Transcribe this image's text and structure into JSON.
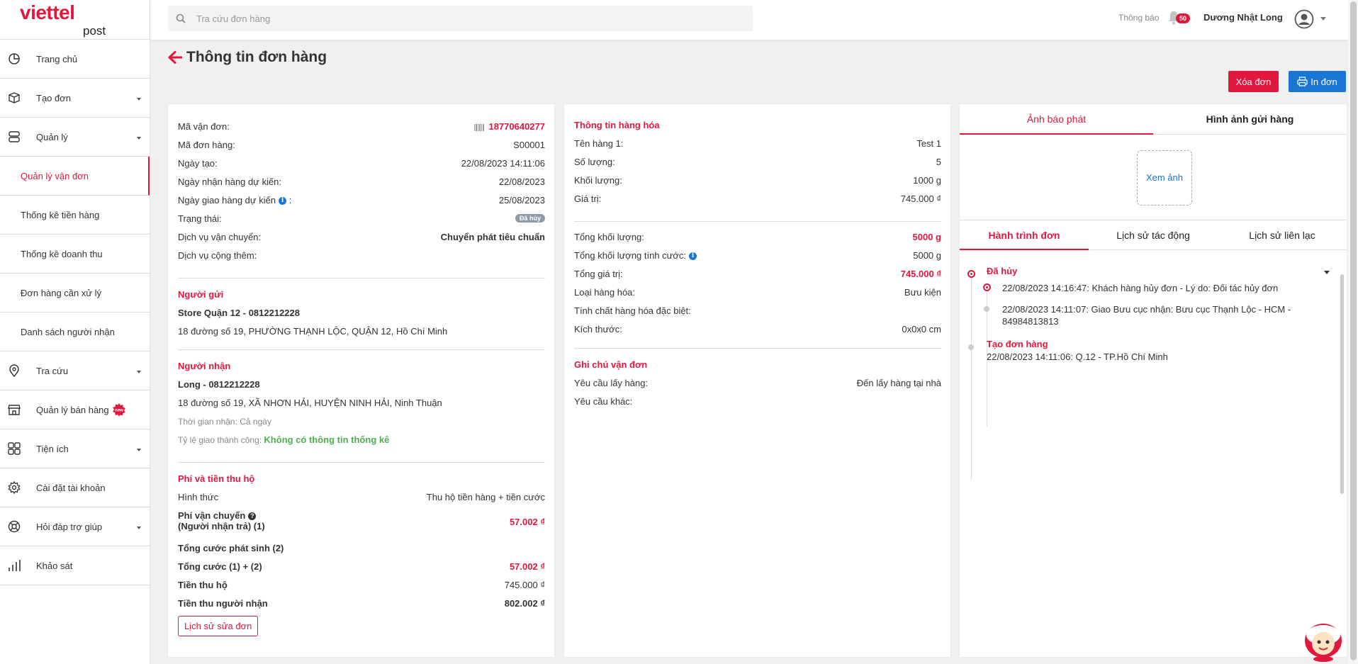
{
  "brand": {
    "logo_main": "viettel",
    "logo_sub": "post",
    "accent": "#e1173e",
    "link": "#1976d2"
  },
  "header": {
    "search_placeholder": "Tra cứu đơn hàng",
    "notif_label": "Thông báo",
    "notif_count": "50",
    "user_name": "Dương Nhật Long"
  },
  "sidebar": {
    "items": [
      {
        "label": "Trang chủ",
        "icon": "pie-chart-icon",
        "has_caret": false
      },
      {
        "label": "Tạo đơn",
        "icon": "box-icon",
        "has_caret": true
      },
      {
        "label": "Quản lý",
        "icon": "server-icon",
        "has_caret": true
      },
      {
        "label": "Quản lý vận đơn",
        "sub": true,
        "active": true
      },
      {
        "label": "Thống kê tiền hàng",
        "sub": true
      },
      {
        "label": "Thống kê doanh thu",
        "sub": true
      },
      {
        "label": "Đơn hàng cần xử lý",
        "sub": true
      },
      {
        "label": "Danh sách người nhận",
        "sub": true
      },
      {
        "label": "Tra cứu",
        "icon": "map-pin-icon",
        "has_caret": true
      },
      {
        "label": "Quản lý bán hàng",
        "icon": "store-icon",
        "has_caret": false,
        "badge": "new"
      },
      {
        "label": "Tiện ích",
        "icon": "grid-icon",
        "has_caret": true
      },
      {
        "label": "Cài đặt tài khoản",
        "icon": "gear-icon",
        "has_caret": false
      },
      {
        "label": "Hỏi đáp trợ giúp",
        "icon": "lifebuoy-icon",
        "has_caret": true
      },
      {
        "label": "Khảo sát",
        "icon": "bar-chart-icon",
        "has_caret": false
      }
    ]
  },
  "page": {
    "title": "Thông tin đơn hàng",
    "delete_label": "Xóa đơn",
    "print_label": "In đơn"
  },
  "order": {
    "tracking_label": "Mã vận đơn:",
    "tracking_value": "18770640277",
    "order_code_label": "Mã đơn hàng:",
    "order_code_value": "S00001",
    "created_label": "Ngày tạo:",
    "created_value": "22/08/2023 14:11:06",
    "expected_pickup_label": "Ngày nhận hàng dự kiến:",
    "expected_pickup_value": "22/08/2023",
    "expected_delivery_label": "Ngày giao hàng dự kiến",
    "expected_delivery_colon": ":",
    "expected_delivery_value": "25/08/2023",
    "status_label": "Trạng thái:",
    "status_value": "Đã hủy",
    "service_label": "Dịch vụ vận chuyển:",
    "service_value": "Chuyển phát tiêu chuẩn",
    "addon_label": "Dịch vụ cộng thêm:"
  },
  "sender": {
    "title": "Người gửi",
    "name_phone": "Store Quận 12 - 0812212228",
    "address": "18 đường số 19, PHƯỜNG THẠNH LỘC, QUẬN 12, Hồ Chí Minh"
  },
  "receiver": {
    "title": "Người nhận",
    "name_phone": "Long - 0812212228",
    "address": "18 đường số 19, XÃ NHƠN HẢI, HUYỆN NINH HẢI, Ninh Thuận",
    "receive_time": "Thời gian nhận: Cả ngày",
    "success_rate_label": "Tỷ lệ giao thành công:",
    "success_rate_value": "Không có thông tin thống kê"
  },
  "fees": {
    "title": "Phí và tiền thu hộ",
    "method_label": "Hình thức",
    "method_value": "Thu hộ tiền hàng + tiền cước",
    "ship_fee_label": "Phí vận chuyển",
    "ship_fee_sub": "(Người nhận trả) (1)",
    "ship_fee_value": "57.002 ₫",
    "extra_label": "Tổng cước phát sinh (2)",
    "total_label": "Tổng cước (1) + (2)",
    "total_value": "57.002 ₫",
    "cod_label": "Tiền thu hộ",
    "cod_value": "745.000 ₫",
    "receiver_pay_label": "Tiền thu người nhận",
    "receiver_pay_value": "802.002 ₫",
    "history_button": "Lịch sử sửa đơn"
  },
  "goods": {
    "title": "Thông tin hàng hóa",
    "item_name_label": "Tên hàng 1:",
    "item_name_value": "Test 1",
    "qty_label": "Số lượng:",
    "qty_value": "5",
    "weight_label": "Khối lượng:",
    "weight_value": "1000 g",
    "value_label": "Giá trị:",
    "value_value": "745.000 ₫",
    "total_weight_label": "Tổng khối lượng:",
    "total_weight_value": "5000 g",
    "charge_weight_label": "Tổng khối lượng tính cước:",
    "charge_weight_value": "5000 g",
    "total_value_label": "Tổng giá trị:",
    "total_value_value": "745.000 ₫",
    "type_label": "Loại hàng hóa:",
    "type_value": "Bưu kiện",
    "special_label": "Tính chất hàng hóa đặc biệt:",
    "size_label": "Kích thước:",
    "size_value": "0x0x0 cm"
  },
  "notes": {
    "title": "Ghi chú vận đơn",
    "pickup_label": "Yêu cầu lấy hàng:",
    "pickup_value": "Đến lấy hàng tại nhà",
    "other_label": "Yêu cầu khác:"
  },
  "media": {
    "tab1": "Ảnh báo phát",
    "tab2": "Hình ảnh gửi hàng",
    "view_label": "Xem ảnh"
  },
  "journey": {
    "tab1": "Hành trình đơn",
    "tab2": "Lịch sử tác động",
    "tab3": "Lịch sử liên lạc",
    "status1_title": "Đã hủy",
    "status1_events": [
      "22/08/2023 14:16:47: Khách hàng hủy đơn - Lý do: Đối tác hủy đơn",
      "22/08/2023 14:11:07: Giao Bưu cục nhận: Bưu cục Thạnh Lộc - HCM - 84984813813"
    ],
    "status2_title": "Tạo đơn hàng",
    "status2_event": "22/08/2023 14:11:06: Q.12 - TP.Hồ Chí Minh"
  }
}
